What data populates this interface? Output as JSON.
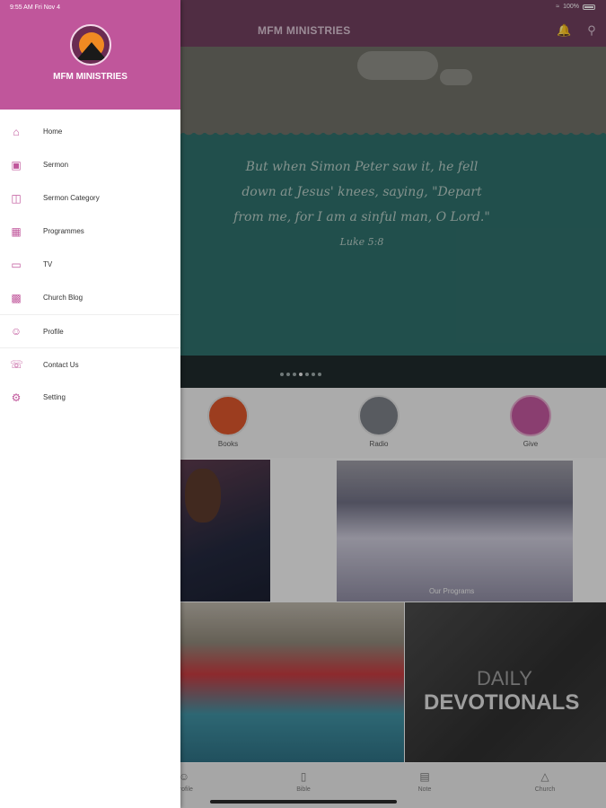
{
  "status_bar": {
    "time": "9:55 AM   Fri Nov 4",
    "battery": "100%"
  },
  "app_bar": {
    "title": "MFM MINISTRIES",
    "icons": [
      "bell-icon",
      "search-icon"
    ]
  },
  "hero": {
    "verse": "But when Simon Peter saw it, he fell down at Jesus' knees, saying, \"Depart from me, for I am a sinful man, O Lord.\"",
    "reference": "Luke 5:8",
    "slide_count": 7,
    "active_slide": 4
  },
  "quick_links": [
    {
      "label": "Books",
      "icon": "books-icon"
    },
    {
      "label": "Radio",
      "icon": "radio-icon"
    },
    {
      "label": "Give",
      "icon": "give-icon"
    }
  ],
  "tiles": {
    "programs_caption": "Our Programs",
    "devotionals_line1": "DAILY",
    "devotionals_line2": "DEVOTIONALS"
  },
  "tab_bar": [
    {
      "label": "Profile",
      "icon": "profile-icon"
    },
    {
      "label": "Bible",
      "icon": "bible-icon"
    },
    {
      "label": "Note",
      "icon": "note-icon"
    },
    {
      "label": "Church",
      "icon": "church-icon"
    }
  ],
  "drawer": {
    "status_time": "9:55 AM   Fri Nov 4",
    "title": "MFM MINISTRIES",
    "items": [
      {
        "label": "Home",
        "icon": "home-icon"
      },
      {
        "label": "Sermon",
        "icon": "sermon-icon"
      },
      {
        "label": "Sermon Category",
        "icon": "sermon-category-icon"
      },
      {
        "label": "Programmes",
        "icon": "calendar-icon"
      },
      {
        "label": "TV",
        "icon": "tv-icon"
      },
      {
        "label": "Church Blog",
        "icon": "blog-icon"
      },
      {
        "label": "Profile",
        "icon": "person-icon"
      },
      {
        "label": "Contact Us",
        "icon": "contact-icon"
      },
      {
        "label": "Setting",
        "icon": "gear-icon"
      }
    ]
  },
  "colors": {
    "drawer_header": "#c0569b",
    "accent": "#c0569b",
    "app_bar": "#6f3f5e"
  }
}
